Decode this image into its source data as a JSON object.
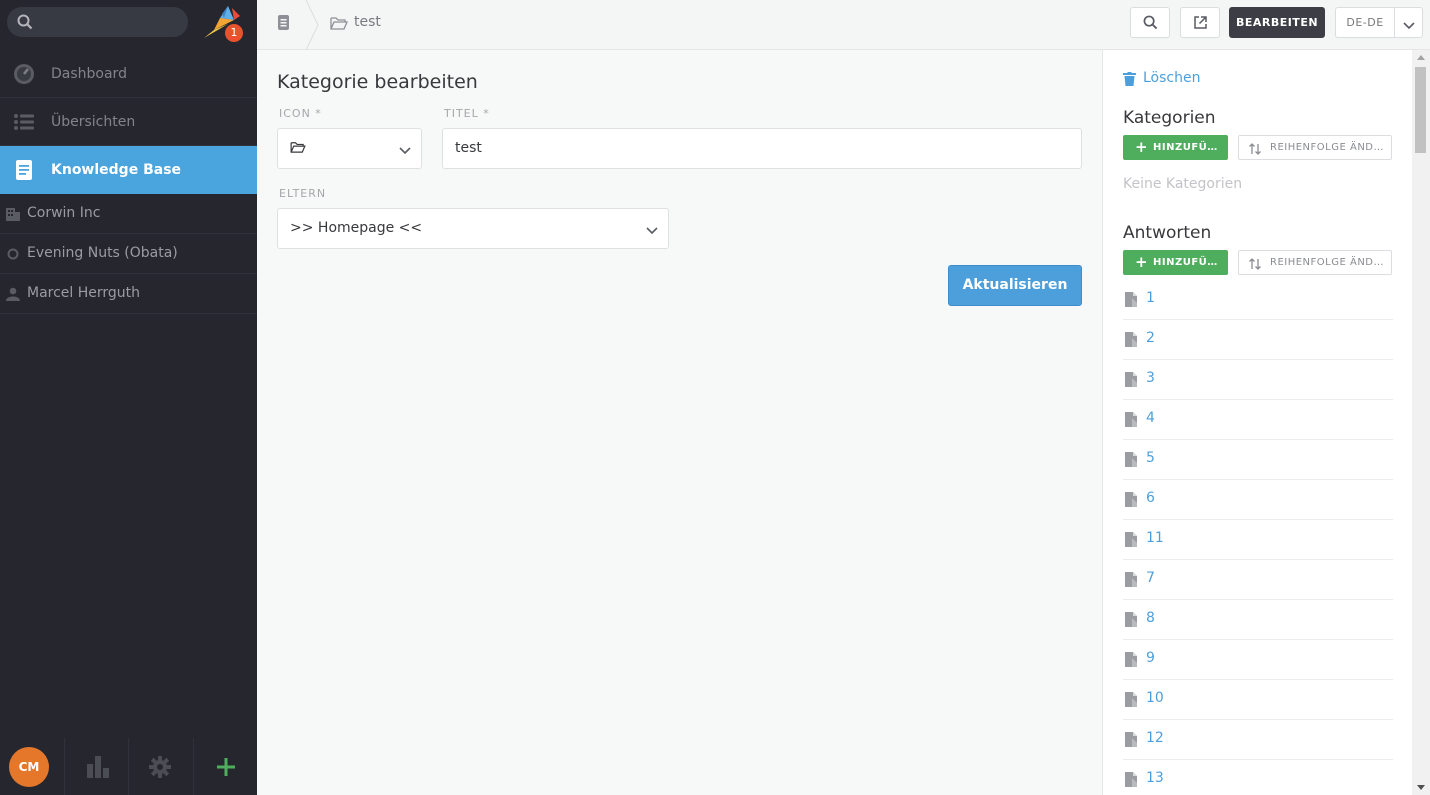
{
  "sidebar": {
    "search_placeholder": "",
    "notification_count": "1",
    "nav": [
      {
        "label": "Dashboard",
        "icon": "dashboard-icon"
      },
      {
        "label": "Übersichten",
        "icon": "list-icon"
      },
      {
        "label": "Knowledge Base",
        "icon": "book-icon"
      }
    ],
    "orgs": [
      {
        "label": "Corwin Inc",
        "icon": "building-icon"
      },
      {
        "label": "Evening Nuts (Obata)",
        "icon": "circle-icon"
      },
      {
        "label": "Marcel Herrguth",
        "icon": "user-icon"
      }
    ],
    "avatar_initials": "CM"
  },
  "topbar": {
    "breadcrumb_label": "test",
    "edit_label": "BEARBEITEN",
    "language": "DE-DE"
  },
  "main": {
    "title": "Kategorie bearbeiten",
    "icon_label": "ICON *",
    "icon_value": "🗁",
    "title_label": "TITEL *",
    "title_value": "test",
    "parent_label": "ELTERN",
    "parent_value": ">> Homepage <<",
    "submit_label": "Aktualisieren"
  },
  "panel": {
    "delete_label": "Löschen",
    "categories_heading": "Kategorien",
    "add_label": "HINZUFÜ…",
    "order_label": "REIHENFOLGE ÄND…",
    "no_categories": "Keine Kategorien",
    "answers_heading": "Antworten",
    "answers": [
      "1",
      "2",
      "3",
      "4",
      "5",
      "6",
      "11",
      "7",
      "8",
      "9",
      "10",
      "12",
      "13"
    ]
  },
  "colors": {
    "sidebar_bg": "#26272e",
    "accent_blue": "#4aa4de",
    "green": "#4fad5e",
    "badge": "#e6532d"
  }
}
